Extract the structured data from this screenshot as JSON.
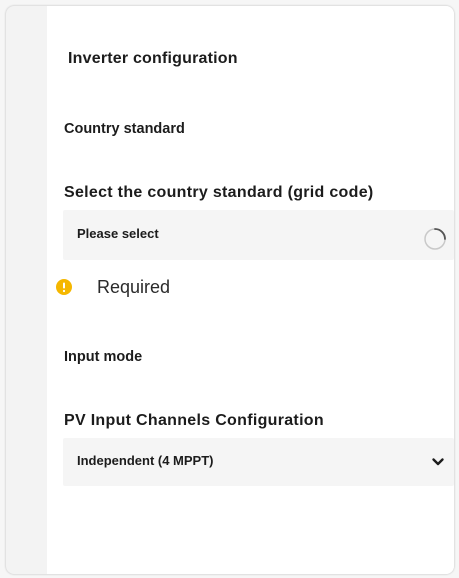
{
  "form": {
    "title": "Inverter configuration",
    "country_section": {
      "heading": "Country standard",
      "field_label": "Select the country standard (grid code)",
      "select_value": "Please select",
      "error_text": "Required"
    },
    "input_section": {
      "heading": "Input mode",
      "field_label": "PV Input Channels Configuration",
      "select_value": "Independent (4 MPPT)"
    }
  },
  "colors": {
    "warning": "#f5b700",
    "text": "#1c1c1c",
    "select_background": "#f5f5f5"
  },
  "icons": {
    "warning": "warning-icon",
    "loading": "loading-spinner-icon",
    "dropdown": "chevron-down-icon"
  }
}
